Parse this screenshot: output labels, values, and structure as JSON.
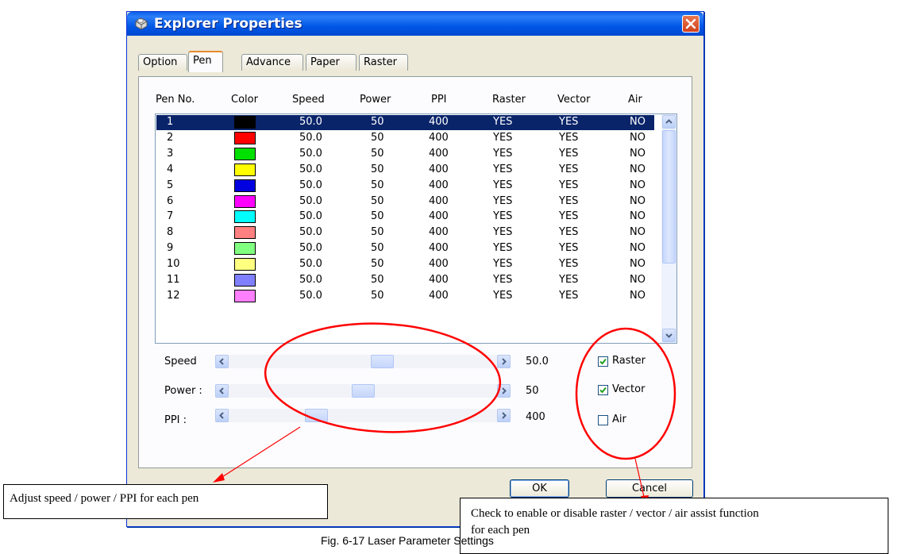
{
  "window": {
    "title": "Explorer Properties"
  },
  "tabs": [
    {
      "label": "Option"
    },
    {
      "label": "Pen"
    },
    {
      "label": "Advance"
    },
    {
      "label": "Paper"
    },
    {
      "label": "Raster"
    }
  ],
  "active_tab": "Pen",
  "table": {
    "columns": [
      "Pen No.",
      "Color",
      "Speed",
      "Power",
      "PPI",
      "Raster",
      "Vector",
      "Air"
    ],
    "rows": [
      {
        "pen": "1",
        "color": "#000000",
        "speed": "50.0",
        "power": "50",
        "ppi": "400",
        "raster": "YES",
        "vector": "YES",
        "air": "NO",
        "selected": true
      },
      {
        "pen": "2",
        "color": "#ff0000",
        "speed": "50.0",
        "power": "50",
        "ppi": "400",
        "raster": "YES",
        "vector": "YES",
        "air": "NO"
      },
      {
        "pen": "3",
        "color": "#00e000",
        "speed": "50.0",
        "power": "50",
        "ppi": "400",
        "raster": "YES",
        "vector": "YES",
        "air": "NO"
      },
      {
        "pen": "4",
        "color": "#ffff00",
        "speed": "50.0",
        "power": "50",
        "ppi": "400",
        "raster": "YES",
        "vector": "YES",
        "air": "NO"
      },
      {
        "pen": "5",
        "color": "#0000e0",
        "speed": "50.0",
        "power": "50",
        "ppi": "400",
        "raster": "YES",
        "vector": "YES",
        "air": "NO"
      },
      {
        "pen": "6",
        "color": "#ff00ff",
        "speed": "50.0",
        "power": "50",
        "ppi": "400",
        "raster": "YES",
        "vector": "YES",
        "air": "NO"
      },
      {
        "pen": "7",
        "color": "#00ffff",
        "speed": "50.0",
        "power": "50",
        "ppi": "400",
        "raster": "YES",
        "vector": "YES",
        "air": "NO"
      },
      {
        "pen": "8",
        "color": "#ff8080",
        "speed": "50.0",
        "power": "50",
        "ppi": "400",
        "raster": "YES",
        "vector": "YES",
        "air": "NO"
      },
      {
        "pen": "9",
        "color": "#80ff80",
        "speed": "50.0",
        "power": "50",
        "ppi": "400",
        "raster": "YES",
        "vector": "YES",
        "air": "NO"
      },
      {
        "pen": "10",
        "color": "#ffff80",
        "speed": "50.0",
        "power": "50",
        "ppi": "400",
        "raster": "YES",
        "vector": "YES",
        "air": "NO"
      },
      {
        "pen": "11",
        "color": "#8080ff",
        "speed": "50.0",
        "power": "50",
        "ppi": "400",
        "raster": "YES",
        "vector": "YES",
        "air": "NO"
      },
      {
        "pen": "12",
        "color": "#ff80ff",
        "speed": "50.0",
        "power": "50",
        "ppi": "400",
        "raster": "YES",
        "vector": "YES",
        "air": "NO"
      }
    ]
  },
  "sliders": {
    "speed": {
      "label": "Speed",
      "value": "50.0",
      "level": 0.58
    },
    "power": {
      "label": "Power :",
      "value": "50",
      "level": 0.5
    },
    "ppi": {
      "label": "PPI :",
      "value": "400",
      "level": 0.31
    }
  },
  "checkboxes": {
    "raster": {
      "label": "Raster",
      "checked": true
    },
    "vector": {
      "label": "Vector",
      "checked": true
    },
    "air": {
      "label": "Air",
      "checked": false
    }
  },
  "buttons": {
    "ok": "OK",
    "cancel": "Cancel"
  },
  "annotations": {
    "sliders_note": "Adjust speed /  power / PPI for each pen",
    "checkbox_note_line1": "Check to enable or disable raster / vector / air assist function",
    "checkbox_note_line2": "for each pen",
    "color": "#ff0000"
  },
  "caption": "Fig. 6-17 Laser Parameter Settings",
  "colors": {
    "selection": "#0a246a",
    "titlebar": "#0058e6",
    "dialog_face": "#ece9d8"
  }
}
